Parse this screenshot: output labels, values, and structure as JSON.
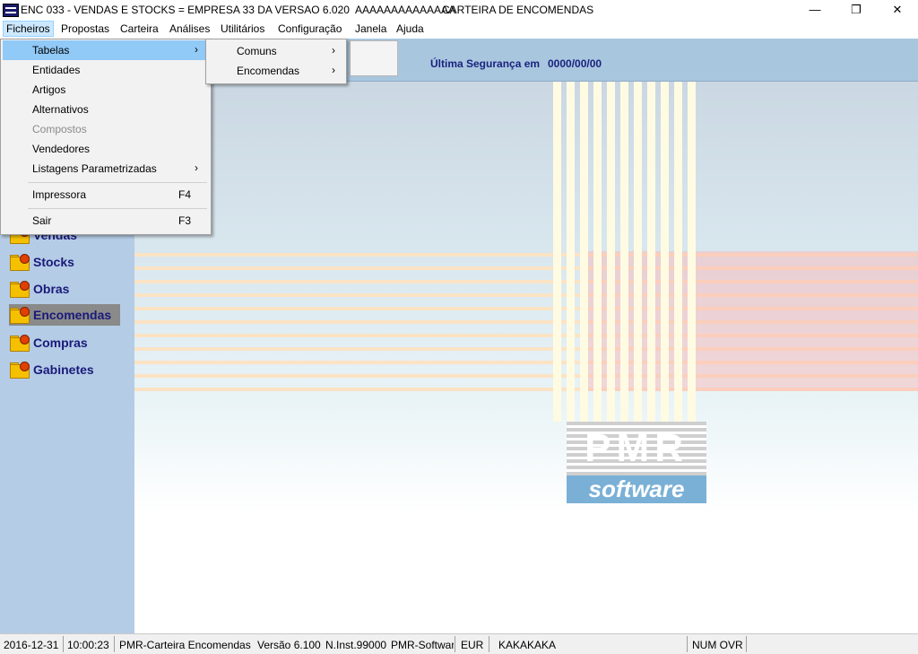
{
  "window": {
    "title": "ENC 033 - VENDAS E STOCKS = EMPRESA 33 DA VERSAO 6.020  AAAAAAAAAAAAAA",
    "module": "CARTEIRA DE ENCOMENDAS",
    "minimize_glyph": "—",
    "restore_glyph": "❐",
    "close_glyph": "✕"
  },
  "menubar": [
    "Ficheiros",
    "Propostas",
    "Carteira",
    "Análises",
    "Utilitários",
    "Configuração",
    "Janela",
    "Ajuda"
  ],
  "header": {
    "backup_label": "Última Segurança em",
    "backup_date": "0000/00/00"
  },
  "dropdown": {
    "items": [
      {
        "label": "Tabelas",
        "shortcut": "",
        "submenu": true,
        "disabled": false,
        "hover": true
      },
      {
        "label": "Entidades",
        "shortcut": "",
        "submenu": false,
        "disabled": false
      },
      {
        "label": "Artigos",
        "shortcut": "",
        "submenu": false,
        "disabled": false
      },
      {
        "label": "Alternativos",
        "shortcut": "",
        "submenu": false,
        "disabled": false
      },
      {
        "label": "Compostos",
        "shortcut": "",
        "submenu": false,
        "disabled": true
      },
      {
        "label": "Vendedores",
        "shortcut": "",
        "submenu": false,
        "disabled": false
      },
      {
        "label": "Listagens Parametrizadas",
        "shortcut": "",
        "submenu": true,
        "disabled": false
      },
      {
        "label": "Impressora",
        "shortcut": "F4",
        "submenu": false,
        "disabled": false
      },
      {
        "label": "Sair",
        "shortcut": "F3",
        "submenu": false,
        "disabled": false
      }
    ],
    "arrow_glyph": "›"
  },
  "submenu": {
    "items": [
      {
        "label": "Comuns"
      },
      {
        "label": "Encomendas"
      }
    ]
  },
  "sidebar": {
    "items": [
      {
        "label": "Vendas"
      },
      {
        "label": "Stocks"
      },
      {
        "label": "Obras"
      },
      {
        "label": "Encomendas",
        "selected": true
      },
      {
        "label": "Compras"
      },
      {
        "label": "Gabinetes"
      }
    ]
  },
  "logo": {
    "brand": "PMR",
    "tagline": "software"
  },
  "statusbar": {
    "date": "2016-12-31",
    "time": "10:00:23",
    "module": "PMR-Carteira Encomendas",
    "version": "Versão  6.100",
    "install": "N.Inst.99000",
    "vendor": "PMR-Software",
    "currency": "EUR",
    "user": "KAKAKAKA",
    "keys": "NUM OVR"
  },
  "colors": {
    "sidebar": "#b4cce6",
    "header_band": "#a9c6df",
    "menu_hover": "#91c9f7",
    "sidebar_text": "#1a1a7a",
    "logo_accent": "#7ab0d6"
  }
}
